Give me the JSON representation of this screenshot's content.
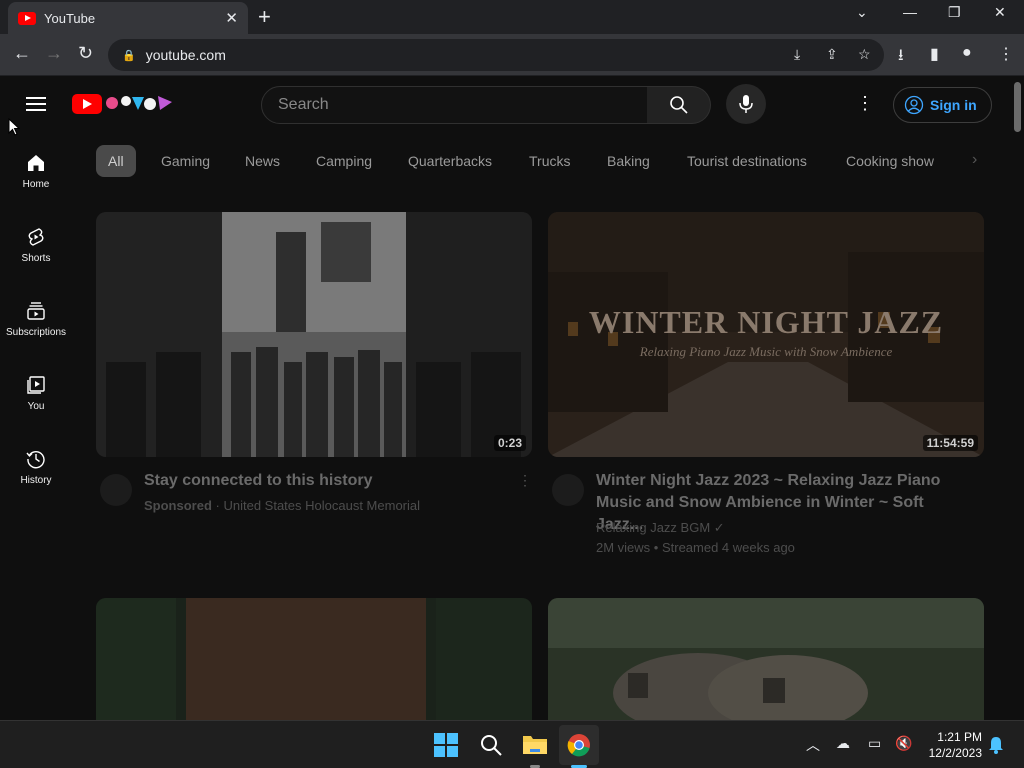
{
  "browser": {
    "tab_title": "YouTube",
    "url": "youtube.com"
  },
  "header": {
    "search_placeholder": "Search",
    "signin_label": "Sign in"
  },
  "sidebar": {
    "items": [
      {
        "label": "Home",
        "icon": "home-icon"
      },
      {
        "label": "Shorts",
        "icon": "shorts-icon"
      },
      {
        "label": "Subscriptions",
        "icon": "subscriptions-icon"
      },
      {
        "label": "You",
        "icon": "you-icon"
      },
      {
        "label": "History",
        "icon": "history-icon"
      }
    ]
  },
  "chips": [
    "All",
    "Gaming",
    "News",
    "Camping",
    "Quarterbacks",
    "Trucks",
    "Baking",
    "Tourist destinations",
    "Cooking show"
  ],
  "videos": [
    {
      "title": "Stay connected to this history",
      "sponsored": "Sponsored",
      "channel": "United States Holocaust Memorial",
      "duration": "0:23"
    },
    {
      "title": "Winter Night Jazz 2023 ~ Relaxing Jazz Piano Music and Snow Ambience in Winter ~ Soft Jazz...",
      "channel": "Relaxing Jazz BGM",
      "stats": "2M views • Streamed 4 weeks ago",
      "duration": "11:54:59",
      "thumb_title": "WINTER NIGHT JAZZ",
      "thumb_subtitle": "Relaxing Piano Jazz Music with Snow Ambience"
    }
  ],
  "taskbar": {
    "time": "1:21 PM",
    "date": "12/2/2023"
  },
  "colors": {
    "youtube_red": "#ff0000",
    "signin_blue": "#3ea6ff",
    "background": "#0f0f0f"
  }
}
